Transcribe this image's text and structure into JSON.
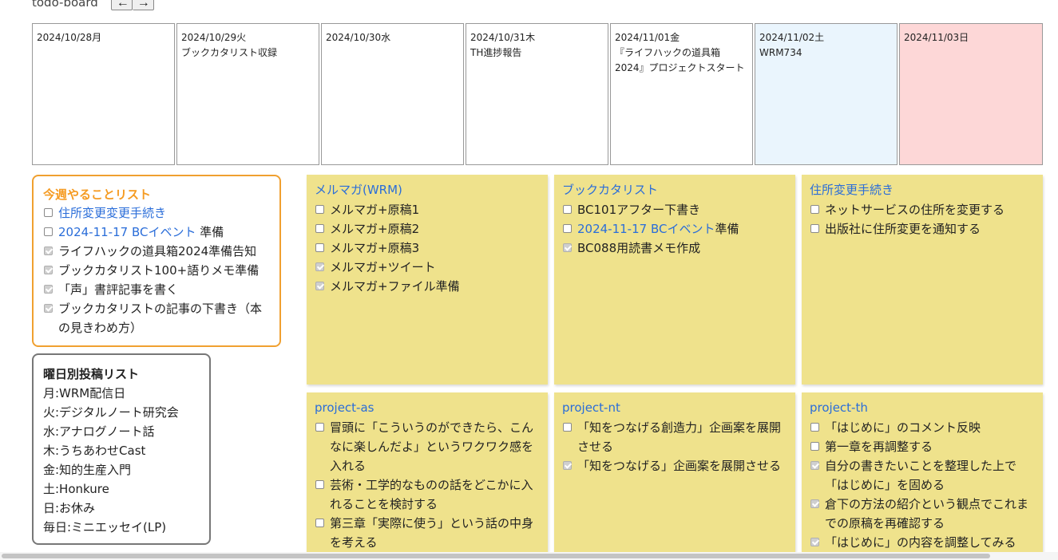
{
  "header": {
    "title": "todo-board",
    "prev_label": "←",
    "next_label": "→"
  },
  "calendar": [
    {
      "date": "2024/10/28月",
      "note": ""
    },
    {
      "date": "2024/10/29火",
      "note": "ブックカタリスト収録"
    },
    {
      "date": "2024/10/30水",
      "note": ""
    },
    {
      "date": "2024/10/31木",
      "note": "TH進捗報告"
    },
    {
      "date": "2024/11/01金",
      "note": "『ライフハックの道具箱2024』プロジェクトスタート"
    },
    {
      "date": "2024/11/02土",
      "note": "WRM734"
    },
    {
      "date": "2024/11/03日",
      "note": ""
    }
  ],
  "weekly": {
    "title": "今週やることリスト",
    "items": [
      {
        "link": "住所変更変更手続き",
        "text": "",
        "checked": false
      },
      {
        "link": "2024-11-17 BCイベント",
        "text": " 準備",
        "checked": false
      },
      {
        "link": "",
        "text": "ライフハックの道具箱2024準備告知",
        "checked": true
      },
      {
        "link": "",
        "text": "ブックカタリスト100+語りメモ準備",
        "checked": true
      },
      {
        "link": "",
        "text": "「声」書評記事を書く",
        "checked": true
      },
      {
        "link": "",
        "text": "ブックカタリストの記事の下書き（本の見きわめ方）",
        "checked": true
      }
    ]
  },
  "posting": {
    "title": "曜日別投稿リスト",
    "lines": [
      "月:WRM配信日",
      "火:デジタルノート研究会",
      "水:アナログノート話",
      "木:うちあわせCast",
      "金:知的生産入門",
      "土:Honkure",
      "日:お休み",
      "毎日:ミニエッセイ(LP)"
    ]
  },
  "cards": [
    {
      "title": "メルマガ(WRM)",
      "items": [
        {
          "link": "",
          "text": "メルマガ+原稿1",
          "checked": false
        },
        {
          "link": "",
          "text": "メルマガ+原稿2",
          "checked": false
        },
        {
          "link": "",
          "text": "メルマガ+原稿3",
          "checked": false
        },
        {
          "link": "",
          "text": "メルマガ+ツイート",
          "checked": true
        },
        {
          "link": "",
          "text": "メルマガ+ファイル準備",
          "checked": true
        }
      ]
    },
    {
      "title": "ブックカタリスト",
      "items": [
        {
          "link": "",
          "text": "BC101アフター下書き",
          "checked": false
        },
        {
          "link": "2024-11-17 BCイベント",
          "text": "準備",
          "checked": false
        },
        {
          "link": "",
          "text": "BC088用読書メモ作成",
          "checked": true
        }
      ]
    },
    {
      "title": "住所変更手続き",
      "items": [
        {
          "link": "",
          "text": "ネットサービスの住所を変更する",
          "checked": false
        },
        {
          "link": "",
          "text": "出版社に住所変更を通知する",
          "checked": false
        }
      ]
    },
    {
      "title": "project-as",
      "items": [
        {
          "link": "",
          "text": "冒頭に「こういうのができたら、こんなに楽しんだよ」というワクワク感を入れる",
          "checked": false
        },
        {
          "link": "",
          "text": "芸術・工学的なものの話をどこかに入れることを検討する",
          "checked": false
        },
        {
          "link": "",
          "text": "第三章「実際に使う」という話の中身を考える",
          "checked": false
        }
      ]
    },
    {
      "title": "project-nt",
      "items": [
        {
          "link": "",
          "text": "「知をつなげる創造力」企画案を展開させる",
          "checked": false
        },
        {
          "link": "",
          "text": "「知をつなげる」企画案を展開させる",
          "checked": true
        }
      ]
    },
    {
      "title": "project-th",
      "items": [
        {
          "link": "",
          "text": "「はじめに」のコメント反映",
          "checked": false
        },
        {
          "link": "",
          "text": "第一章を再調整する",
          "checked": false
        },
        {
          "link": "",
          "text": "自分の書きたいことを整理した上で「はじめに」を固める",
          "checked": true
        },
        {
          "link": "",
          "text": "倉下の方法の紹介という観点でこれまでの原稿を再確認する",
          "checked": true
        },
        {
          "link": "",
          "text": "「はじめに」の内容を調整してみる",
          "checked": true
        }
      ]
    }
  ]
}
